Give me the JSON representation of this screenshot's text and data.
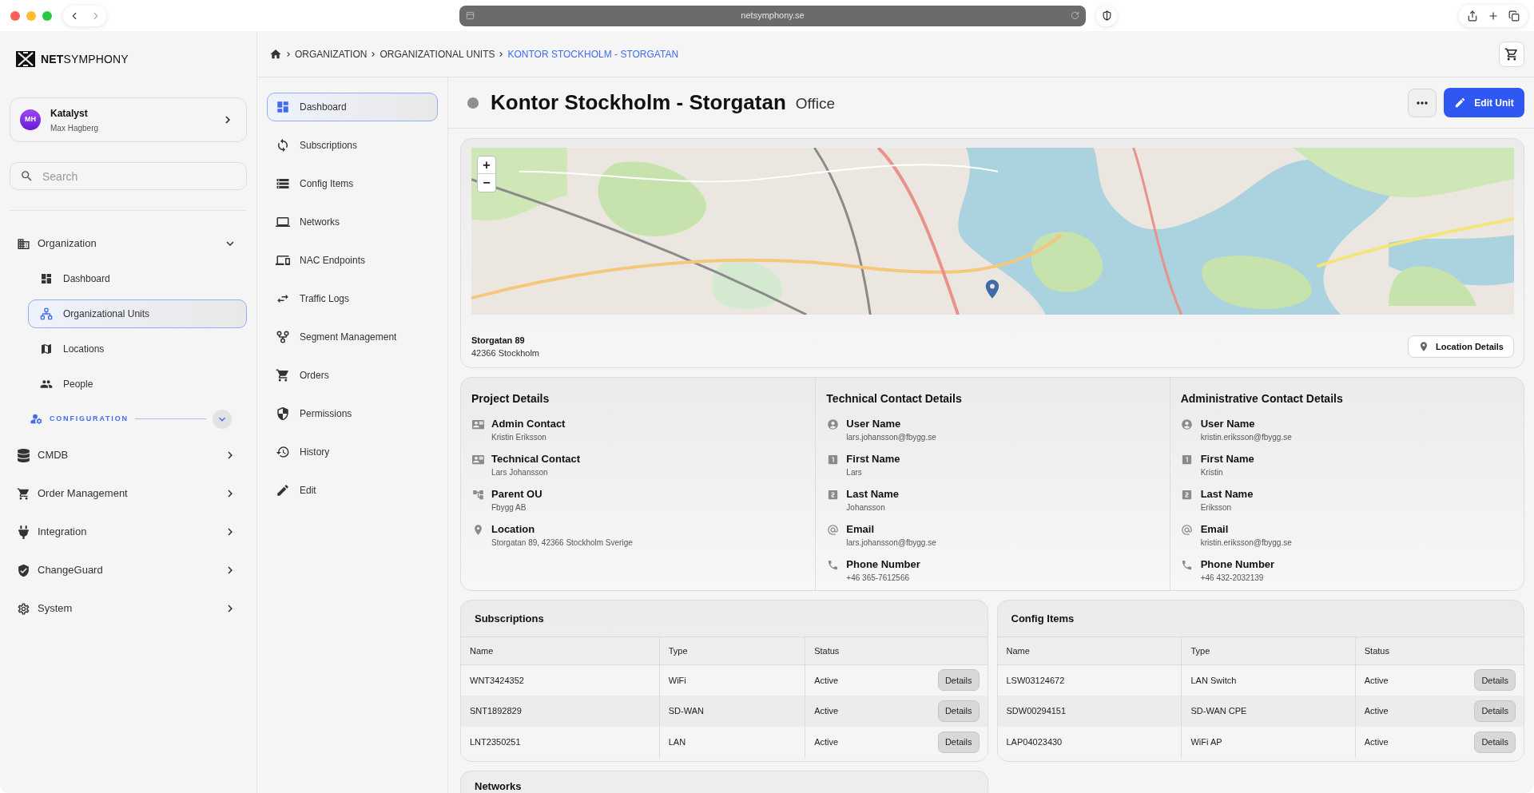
{
  "browser": {
    "url": "netsymphony.se"
  },
  "brand": {
    "name": "**NET**SYMPHONY"
  },
  "account": {
    "initials": "MH",
    "organization": "Katalyst",
    "user": "Max Hagberg"
  },
  "search": {
    "placeholder": "Search"
  },
  "nav": [
    {
      "kind": "group",
      "label": "Organization",
      "expanded": true,
      "children": [
        {
          "label": "Dashboard",
          "selected": false
        },
        {
          "label": "Organizational Units",
          "selected": true
        },
        {
          "label": "Locations",
          "selected": false
        },
        {
          "label": "People",
          "selected": false
        }
      ]
    },
    {
      "kind": "section",
      "label": "CONFIGURATION",
      "expanded": true
    },
    {
      "kind": "group",
      "label": "CMDB",
      "expanded": false
    },
    {
      "kind": "group",
      "label": "Order Management",
      "expanded": false
    },
    {
      "kind": "group",
      "label": "Integration",
      "expanded": false
    },
    {
      "kind": "group",
      "label": "ChangeGuard",
      "expanded": false
    },
    {
      "kind": "group",
      "label": "System",
      "expanded": false
    }
  ],
  "breadcrumb": [
    {
      "label": "ORGANIZATION",
      "current": false
    },
    {
      "label": "ORGANIZATIONAL UNITS",
      "current": false
    },
    {
      "label": "KONTOR STOCKHOLM - STORGATAN",
      "current": true
    }
  ],
  "unit_nav": [
    {
      "label": "Dashboard",
      "selected": true
    },
    {
      "label": "Subscriptions",
      "selected": false
    },
    {
      "label": "Config Items",
      "selected": false
    },
    {
      "label": "Networks",
      "selected": false
    },
    {
      "label": "NAC Endpoints",
      "selected": false
    },
    {
      "label": "Traffic Logs",
      "selected": false
    },
    {
      "label": "Segment Management",
      "selected": false
    },
    {
      "label": "Orders",
      "selected": false
    },
    {
      "label": "Permissions",
      "selected": false
    },
    {
      "label": "History",
      "selected": false
    },
    {
      "label": "Edit",
      "selected": false
    }
  ],
  "header": {
    "online": false,
    "title": "Kontor Stockholm - Storgatan",
    "type": "Office",
    "edit_button": "Edit Unit"
  },
  "map": {
    "zoom_in": "+",
    "zoom_out": "−",
    "street": "Storgatan 89",
    "city": "42366 Stockholm",
    "button": "Location Details"
  },
  "details": [
    {
      "title": "Project Details",
      "fields": [
        {
          "kind": "contact",
          "label": "Admin Contact",
          "value": "Kristin Eriksson"
        },
        {
          "kind": "contact",
          "label": "Technical Contact",
          "value": "Lars Johansson"
        },
        {
          "kind": "parent",
          "label": "Parent OU",
          "value": "Fbygg AB"
        },
        {
          "kind": "location",
          "label": "Location",
          "value": "Storgatan 89, 42366 Stockholm Sverige"
        }
      ]
    },
    {
      "title": "Technical Contact Details",
      "fields": [
        {
          "kind": "username",
          "label": "User Name",
          "value": "lars.johansson@fbygg.se"
        },
        {
          "kind": "first_name",
          "label": "First Name",
          "value": "Lars"
        },
        {
          "kind": "last_name",
          "label": "Last Name",
          "value": "Johansson"
        },
        {
          "kind": "email",
          "label": "Email",
          "value": "lars.johansson@fbygg.se"
        },
        {
          "kind": "phone",
          "label": "Phone Number",
          "value": "+46 365-7612566"
        }
      ]
    },
    {
      "title": "Administrative Contact Details",
      "fields": [
        {
          "kind": "username",
          "label": "User Name",
          "value": "kristin.eriksson@fbygg.se"
        },
        {
          "kind": "first_name",
          "label": "First Name",
          "value": "Kristin"
        },
        {
          "kind": "last_name",
          "label": "Last Name",
          "value": "Eriksson"
        },
        {
          "kind": "email",
          "label": "Email",
          "value": "kristin.eriksson@fbygg.se"
        },
        {
          "kind": "phone",
          "label": "Phone Number",
          "value": "+46 432-2032139"
        }
      ]
    }
  ],
  "tables": [
    {
      "title": "Subscriptions",
      "columns": [
        "Name",
        "Type",
        "Status"
      ],
      "rows": [
        {
          "cells": [
            "WNT3424352",
            "WiFi",
            "Active"
          ],
          "action": "Details"
        },
        {
          "cells": [
            "SNT1892829",
            "SD-WAN",
            "Active"
          ],
          "action": "Details"
        },
        {
          "cells": [
            "LNT2350251",
            "LAN",
            "Active"
          ],
          "action": "Details"
        }
      ]
    },
    {
      "title": "Config Items",
      "columns": [
        "Name",
        "Type",
        "Status"
      ],
      "rows": [
        {
          "cells": [
            "LSW03124672",
            "LAN Switch",
            "Active"
          ],
          "action": "Details"
        },
        {
          "cells": [
            "SDW00294151",
            "SD-WAN CPE",
            "Active"
          ],
          "action": "Details"
        },
        {
          "cells": [
            "LAP04023430",
            "WiFi AP",
            "Active"
          ],
          "action": "Details"
        }
      ]
    }
  ],
  "networks": {
    "title": "Networks"
  }
}
